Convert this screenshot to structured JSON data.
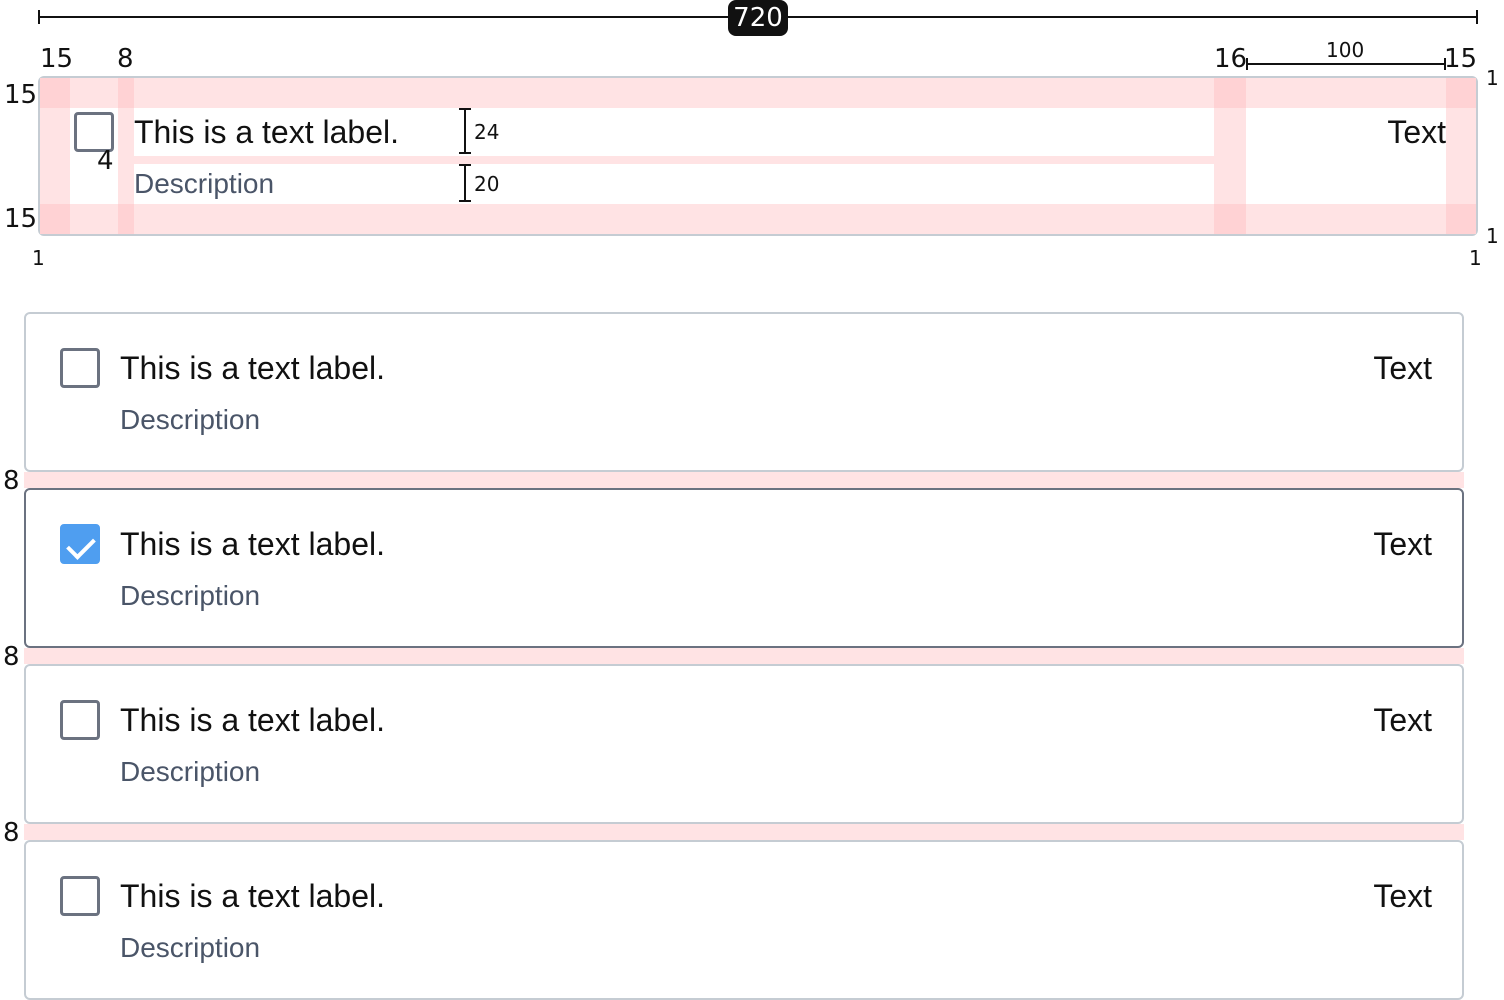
{
  "spec": {
    "total_width": "720",
    "padding_left": "15",
    "gap_left": "8",
    "gap_right": "16",
    "right_width": "100",
    "padding_right": "15",
    "padding_top": "15",
    "padding_bottom": "15",
    "label_gap": "4",
    "label_height": "24",
    "desc_height": "20",
    "border": "1",
    "label": "This is a text label.",
    "description": "Description",
    "right_text": "Text"
  },
  "cards": [
    {
      "label": "This is a text label.",
      "description": "Description",
      "right_text": "Text",
      "checked": false
    },
    {
      "label": "This is a text label.",
      "description": "Description",
      "right_text": "Text",
      "checked": true
    },
    {
      "label": "This is a text label.",
      "description": "Description",
      "right_text": "Text",
      "checked": false
    },
    {
      "label": "This is a text label.",
      "description": "Description",
      "right_text": "Text",
      "checked": false
    }
  ],
  "gap_label": "8",
  "colors": {
    "accent": "#4f9ef0",
    "border": "#c5ccd3",
    "selected_border": "#6b7280",
    "spacing_highlight": "#ffe3e4"
  }
}
